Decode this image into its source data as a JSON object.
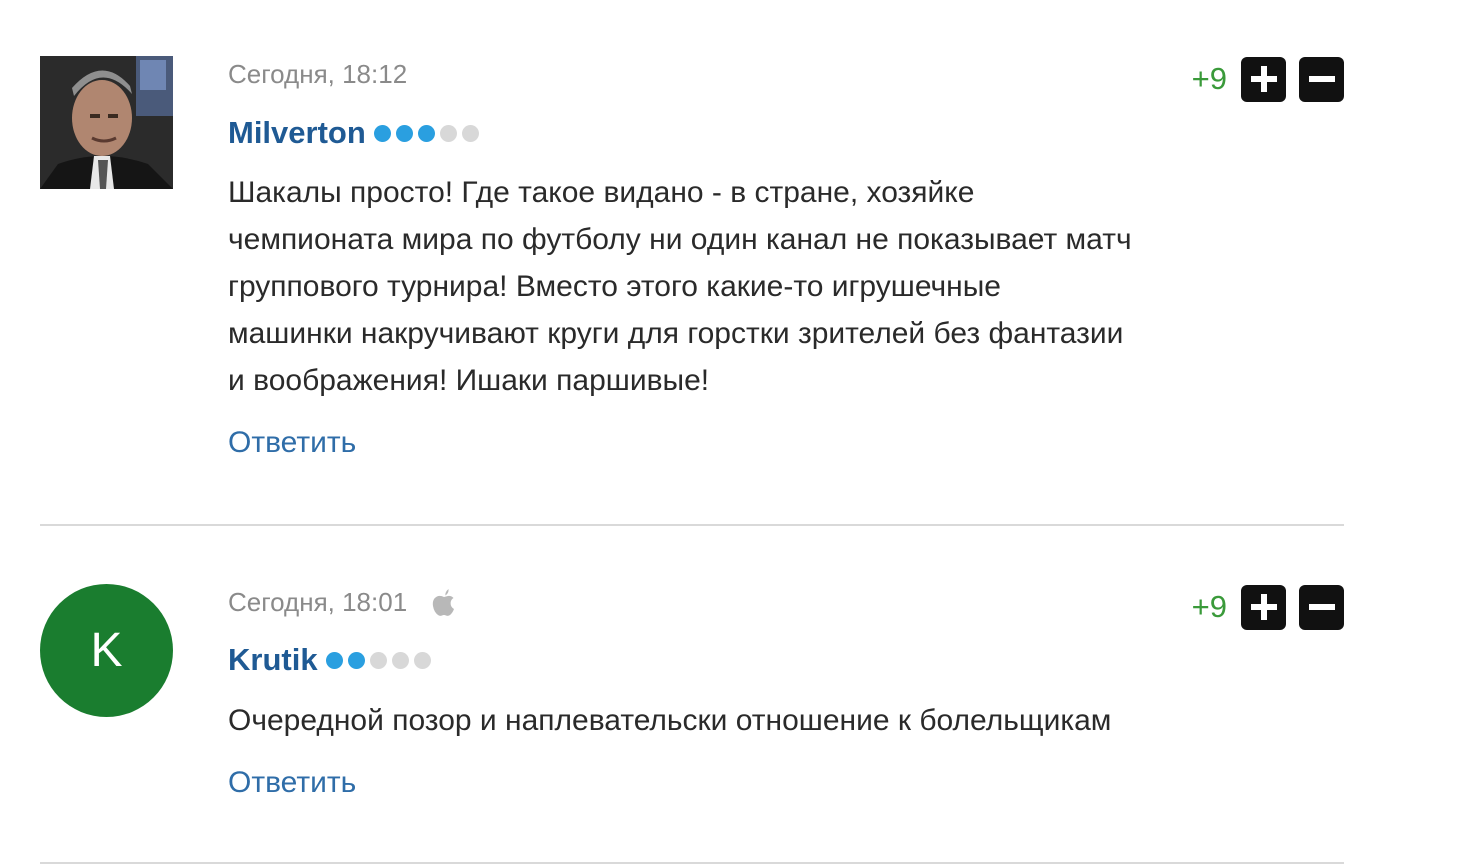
{
  "comments": [
    {
      "time": "Сегодня, 18:12",
      "author": "Milverton",
      "rating_dots": 3,
      "rating_max": 5,
      "score": "+9",
      "text_lines": [
        "Шакалы просто! Где такое видано - в стране, хозяйке",
        "чемпионата мира по футболу ни один канал не показывает матч",
        "группового турнира! Вместо этого какие-то игрушечные",
        "машинки накручивают круги для горстки зрителей без фантазии",
        "и воображения! Ишаки паршивые!"
      ],
      "reply_label": "Ответить",
      "avatar": "photo",
      "device_icon": ""
    },
    {
      "time": "Сегодня, 18:01",
      "author": "Krutik",
      "rating_dots": 2,
      "rating_max": 5,
      "score": "+9",
      "text_lines": [
        "Очередной позор и наплевательски отношение к болельщикам"
      ],
      "reply_label": "Ответить",
      "avatar": "letter",
      "avatar_letter": "K",
      "avatar_color": "#1a7d2f",
      "device_icon": "apple-icon"
    }
  ],
  "colors": {
    "author": "#1f5a94",
    "reply": "#2f6da8",
    "score": "#3a9a3a",
    "dot_active": "#2a9fe0",
    "dot_inactive": "#d8d8d8",
    "vote_button": "#111111"
  }
}
